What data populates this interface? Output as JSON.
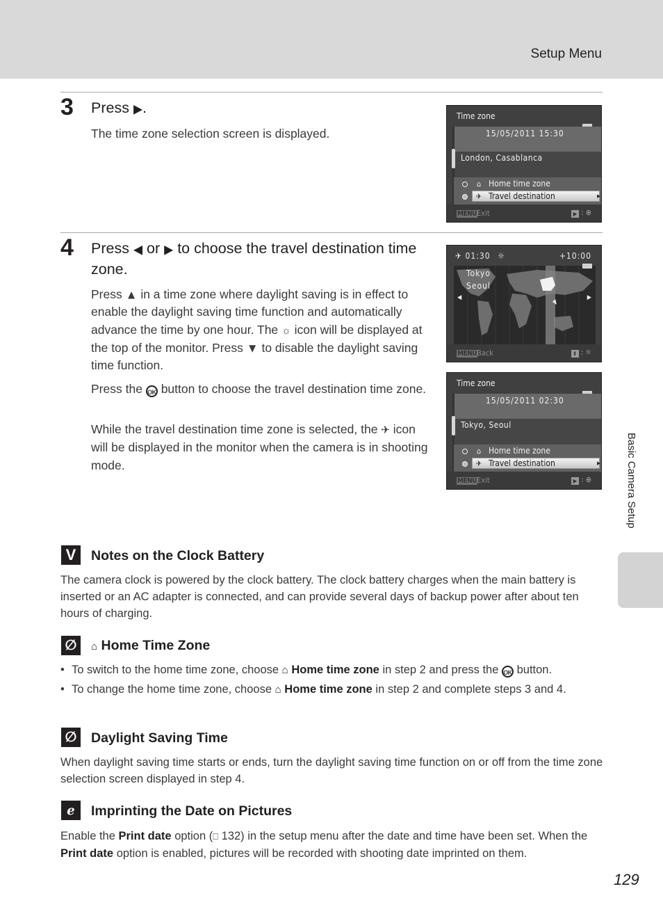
{
  "header": {
    "section_title": "Setup Menu"
  },
  "side_tab": {
    "label": "Basic Camera Setup"
  },
  "page_number": "129",
  "step3": {
    "number": "3",
    "heading_prefix": "Press",
    "heading_arrow": "▶",
    "heading_suffix": ".",
    "body": "The time zone selection screen is displayed."
  },
  "step4": {
    "number": "4",
    "heading_part1": "Press",
    "arrow_left": "◀",
    "heading_part2": "or",
    "arrow_right": "▶",
    "heading_part3": "to choose the travel destination time zone.",
    "p1_a": "Press",
    "arrow_up": "▲",
    "p1_b": "in a time zone where daylight saving is in effect to enable the daylight saving time function and automatically advance the time by one hour. The",
    "p1_c": "icon will be displayed at the top of the monitor. Press",
    "arrow_down": "▼",
    "p1_d": "to disable the daylight saving time function.",
    "p2_a": "Press the",
    "ok_label": "OK",
    "p2_b": "button to choose the travel destination time zone.",
    "p3_a": "While the travel destination time zone is selected, the",
    "p3_b": "icon will be displayed in the monitor when the camera is in shooting mode."
  },
  "screens": [
    {
      "title": "Time zone",
      "datetime": "15/05/2011 15:30",
      "city": "London, Casablanca",
      "options": [
        {
          "label": "Home time zone",
          "icon": "home-icon",
          "selected": false
        },
        {
          "label": "Travel destination",
          "icon": "plane-icon",
          "selected": true
        }
      ],
      "footer_key": "MENU",
      "footer_label": "Exit",
      "footer_hint_key": "▶",
      "footer_hint_icon": "⊕"
    },
    {
      "time": "01:30",
      "offset": "+10:00",
      "cities": [
        "Tokyo",
        "Seoul"
      ],
      "footer_key": "MENU",
      "footer_label": "Back",
      "footer_hint_key": "⬍",
      "footer_hint_icon": "☼"
    },
    {
      "title": "Time zone",
      "datetime": "15/05/2011 02:30",
      "city": "Tokyo, Seoul",
      "options": [
        {
          "label": "Home time zone",
          "icon": "home-icon",
          "selected": false
        },
        {
          "label": "Travel destination",
          "icon": "plane-icon",
          "selected": true
        }
      ],
      "footer_key": "MENU",
      "footer_label": "Exit",
      "footer_hint_key": "▶",
      "footer_hint_icon": "⊕"
    }
  ],
  "notes": {
    "clock_battery": {
      "icon": "V",
      "title": "Notes on the Clock Battery",
      "body": "The camera clock is powered by the clock battery. The clock battery charges when the main battery is inserted or an AC adapter is connected, and can provide several days of backup power after about ten hours of charging."
    },
    "home_time_zone": {
      "title": "Home Time Zone",
      "bullets": [
        {
          "a": "To switch to the home time zone, choose",
          "bold": "Home time zone",
          "b": "in step 2 and press the",
          "ok": "OK",
          "c": "button."
        },
        {
          "a": "To change the home time zone, choose",
          "bold": "Home time zone",
          "b": "in step 2 and complete steps 3 and 4."
        }
      ]
    },
    "daylight_saving": {
      "title": "Daylight Saving Time",
      "body": "When daylight saving time starts or ends, turn the daylight saving time function on or off from the time zone selection screen displayed in step 4."
    },
    "imprinting": {
      "title": "Imprinting the Date on Pictures",
      "a": "Enable the",
      "bold1": "Print date",
      "b": "option (",
      "ref_icon": "📖",
      "c": "132) in the setup menu after the date and time have been set. When the",
      "bold2": "Print date",
      "d": "option is enabled, pictures will be recorded with shooting date imprinted on them."
    }
  }
}
